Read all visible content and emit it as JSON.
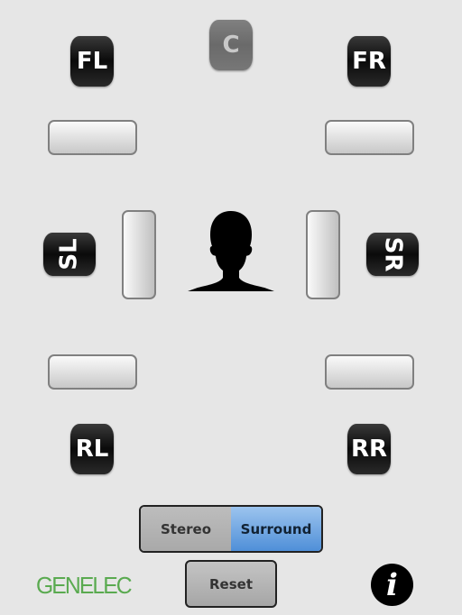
{
  "speakers": {
    "fl": "FL",
    "c": "C",
    "fr": "FR",
    "sl": "SL",
    "sr": "SR",
    "rl": "RL",
    "rr": "RR"
  },
  "mode": {
    "stereo": "Stereo",
    "surround": "Surround",
    "selected": "Surround"
  },
  "reset": "Reset",
  "logo": "GENELEC",
  "colors": {
    "accent": "#4f8fd8",
    "logo": "#5aaa50"
  },
  "icons": {
    "info": "info-icon",
    "listener": "head-silhouette-icon"
  }
}
